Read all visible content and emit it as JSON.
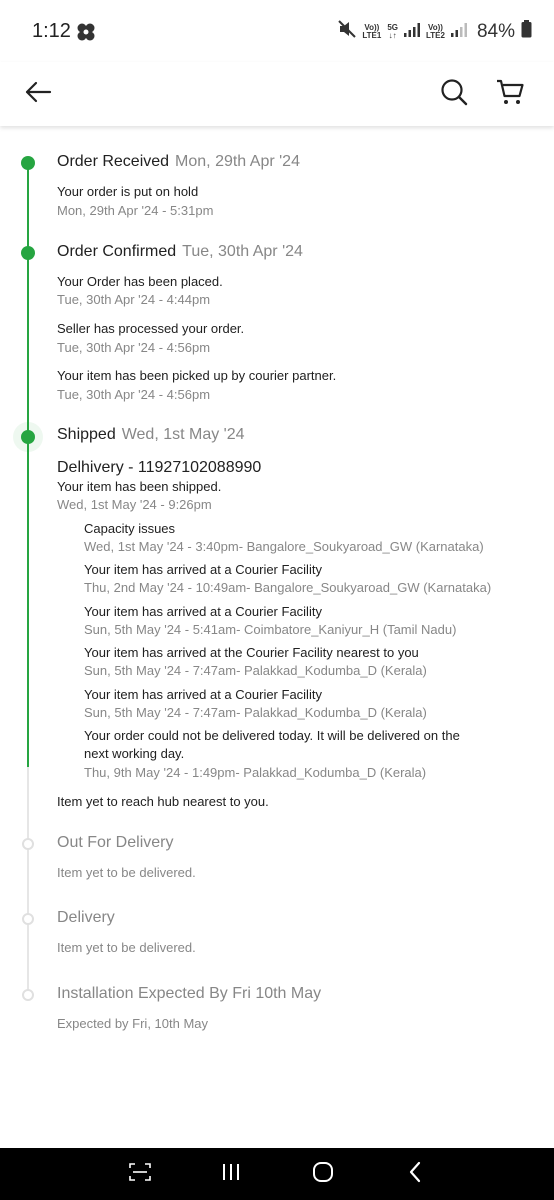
{
  "status_bar": {
    "time": "1:12",
    "sim1": {
      "top": "Vo))",
      "bottom": "LTE1"
    },
    "network_type": "5G",
    "sim2": {
      "top": "Vo))",
      "bottom": "LTE2"
    },
    "battery": "84%"
  },
  "header": {
    "back_icon": "arrow-left-icon",
    "search_icon": "search-icon",
    "cart_icon": "cart-icon"
  },
  "timeline": {
    "accent_color": "#26a541",
    "stages": [
      {
        "title": "Order Received",
        "date": "Mon, 29th Apr '24",
        "events": [
          {
            "text": "Your order is put on hold",
            "time": "Mon, 29th Apr '24 - 5:31pm"
          }
        ]
      },
      {
        "title": "Order Confirmed",
        "date": "Tue, 30th Apr '24",
        "events": [
          {
            "text": "Your Order has been placed.",
            "time": "Tue, 30th Apr '24 - 4:44pm"
          },
          {
            "text": "Seller has processed your order.",
            "time": "Tue, 30th Apr '24 - 4:56pm"
          },
          {
            "text": "Your item has been picked up by courier partner.",
            "time": "Tue, 30th Apr '24 - 4:56pm"
          }
        ]
      },
      {
        "title": "Shipped",
        "date": "Wed, 1st May '24",
        "courier": "Delhivery - 11927102088990",
        "events": [
          {
            "text": "Your item has been shipped.",
            "time": "Wed, 1st May '24 - 9:26pm"
          }
        ],
        "tracking": [
          {
            "text": "Capacity issues",
            "time": "Wed, 1st May '24 - 3:40pm- Bangalore_Soukyaroad_GW (Karnataka)"
          },
          {
            "text": "Your item has arrived at a Courier Facility",
            "time": "Thu, 2nd May '24 - 10:49am- Bangalore_Soukyaroad_GW (Karnataka)"
          },
          {
            "text": "Your item has arrived at a Courier Facility",
            "time": "Sun, 5th May '24 - 5:41am- Coimbatore_Kaniyur_H (Tamil Nadu)"
          },
          {
            "text": "Your item has arrived at the Courier Facility nearest to you",
            "time": "Sun, 5th May '24 - 7:47am- Palakkad_Kodumba_D (Kerala)"
          },
          {
            "text": "Your item has arrived at a Courier Facility",
            "time": "Sun, 5th May '24 - 7:47am- Palakkad_Kodumba_D (Kerala)"
          },
          {
            "text_line1": "Your order could not be delivered today. It will be delivered on the",
            "text_line2": "next working day.",
            "time": "Thu, 9th May '24 - 1:49pm- Palakkad_Kodumba_D (Kerala)"
          }
        ],
        "footer": "Item yet to reach hub nearest to you."
      }
    ],
    "pending": [
      {
        "title": "Out For Delivery",
        "text": "Item yet to be delivered."
      },
      {
        "title": "Delivery",
        "text": "Item yet to be delivered."
      },
      {
        "title": "Installation Expected By Fri 10th May",
        "text": "Expected by Fri, 10th May"
      }
    ]
  },
  "nav_bar": {
    "recents_icon": "recent-apps-icon",
    "home_icon": "home-icon",
    "back_icon": "nav-back-icon"
  }
}
